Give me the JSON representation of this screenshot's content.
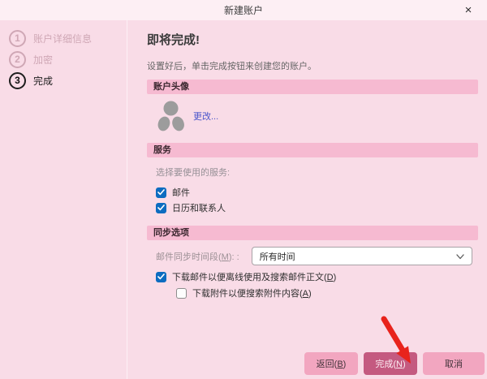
{
  "window": {
    "title": "新建账户",
    "close_glyph": "×"
  },
  "wizard_steps": [
    {
      "number": "1",
      "label": "账户详细信息",
      "active": false
    },
    {
      "number": "2",
      "label": "加密",
      "active": false
    },
    {
      "number": "3",
      "label": "完成",
      "active": true
    }
  ],
  "main": {
    "heading": "即将完成!",
    "subheading": "设置好后，单击完成按钮来创建您的账户。",
    "avatar_section": {
      "title": "账户头像",
      "avatar_icon": "default-account-avatar",
      "change_link": "更改..."
    },
    "services_section": {
      "title": "服务",
      "prompt": "选择要使用的服务:",
      "options": [
        {
          "label": "邮件",
          "checked": true
        },
        {
          "label": "日历和联系人",
          "checked": true
        }
      ]
    },
    "sync_section": {
      "title": "同步选项",
      "period_label": {
        "pre": "邮件同步时间段(",
        "key": "M",
        "post": "): :"
      },
      "period_value": "所有时间",
      "download_mail": {
        "pre": "下载邮件以便离线使用及搜索邮件正文(",
        "key": "D",
        "post": ")",
        "checked": true
      },
      "download_attachments": {
        "pre": "下载附件以便搜索附件内容(",
        "key": "A",
        "post": ")",
        "checked": false
      }
    }
  },
  "footer": {
    "back": {
      "pre": "返回(",
      "key": "B",
      "post": ")"
    },
    "finish": {
      "pre": "完成(",
      "key": "N",
      "post": ")"
    },
    "cancel": "取消"
  },
  "annotation": {
    "type": "red-arrow",
    "points_at": "finish-button"
  },
  "colors": {
    "bg": "#f9dce7",
    "titlebar_bg": "#fdeff4",
    "divider": "#fdf0f6",
    "section_bar_bg": "#f6bad1",
    "step_inactive": "#cfa7b5",
    "button_bg": "#f2a6c0",
    "button_primary_bg": "#c45a80",
    "button_primary_text": "#fdeef4",
    "checkbox_blue": "#0d6cc0",
    "link_blue": "#4b55cb",
    "arrow_red": "#e8231c"
  }
}
